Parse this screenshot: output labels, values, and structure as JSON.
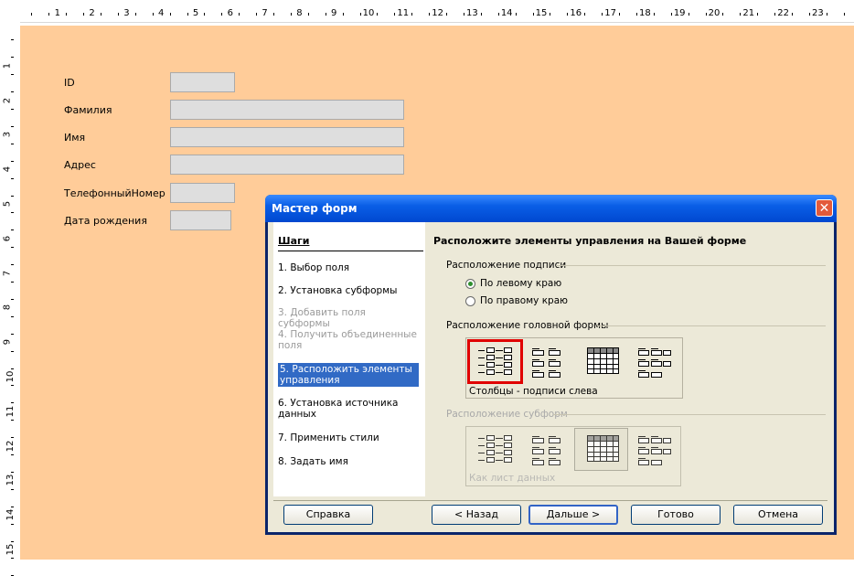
{
  "ruler": {
    "h_numbers": [
      "1",
      "2",
      "3",
      "4",
      "5",
      "6",
      "7",
      "8",
      "9",
      "10",
      "11",
      "12",
      "13",
      "14",
      "15",
      "16",
      "17",
      "18",
      "19",
      "20",
      "21",
      "22",
      "23"
    ],
    "v_numbers": [
      "1",
      "2",
      "3",
      "4",
      "5",
      "6",
      "7",
      "8",
      "9",
      "10",
      "11",
      "12",
      "13",
      "14",
      "15"
    ]
  },
  "form": {
    "background": "#ffcc99",
    "fields": [
      {
        "label": "ID"
      },
      {
        "label": "Фамилия"
      },
      {
        "label": "Имя"
      },
      {
        "label": "Адрес"
      },
      {
        "label": "ТелефонныйНомер"
      },
      {
        "label": "Дата рождения"
      }
    ]
  },
  "dialog": {
    "title": "Мастер форм",
    "close_icon": "close-icon",
    "steps_header": "Шаги",
    "steps": [
      {
        "label": "1. Выбор поля",
        "state": "normal"
      },
      {
        "label": "2. Установка субформы",
        "state": "normal"
      },
      {
        "label": "3. Добавить поля субформы",
        "state": "disabled"
      },
      {
        "label": "4. Получить объединенные поля",
        "state": "disabled"
      },
      {
        "label": "5. Расположить элементы управления",
        "state": "active"
      },
      {
        "label": "6. Установка источника данных",
        "state": "normal"
      },
      {
        "label": "7. Применить стили",
        "state": "normal"
      },
      {
        "label": "8. Задать имя",
        "state": "normal"
      }
    ],
    "panel_title": "Расположите элементы управления на Вашей форме",
    "label_placement": {
      "header": "Расположение подписи",
      "options": [
        {
          "label": "По левому краю",
          "selected": true
        },
        {
          "label": "По правому краю",
          "selected": false
        }
      ]
    },
    "main_layout": {
      "header": "Расположение головной формы",
      "caption": "Столбцы - подписи слева",
      "options": [
        "columns-labels-left-icon",
        "columns-labels-top-icon",
        "datasheet-icon",
        "blocks-labels-top-icon"
      ],
      "selected_index": 0
    },
    "sub_layout": {
      "header": "Расположение субформ",
      "caption": "Как лист данных",
      "options": [
        "columns-labels-left-icon",
        "columns-labels-top-icon",
        "datasheet-icon",
        "blocks-labels-top-icon"
      ],
      "selected_index": 2
    },
    "buttons": {
      "help": "Справка",
      "back": "< Назад",
      "next": "Дальше >",
      "finish": "Готово",
      "cancel": "Отмена"
    },
    "colors": {
      "titlebar": "#0a5ee6",
      "highlight": "#316ac5",
      "selection_frame": "#e00000"
    }
  }
}
